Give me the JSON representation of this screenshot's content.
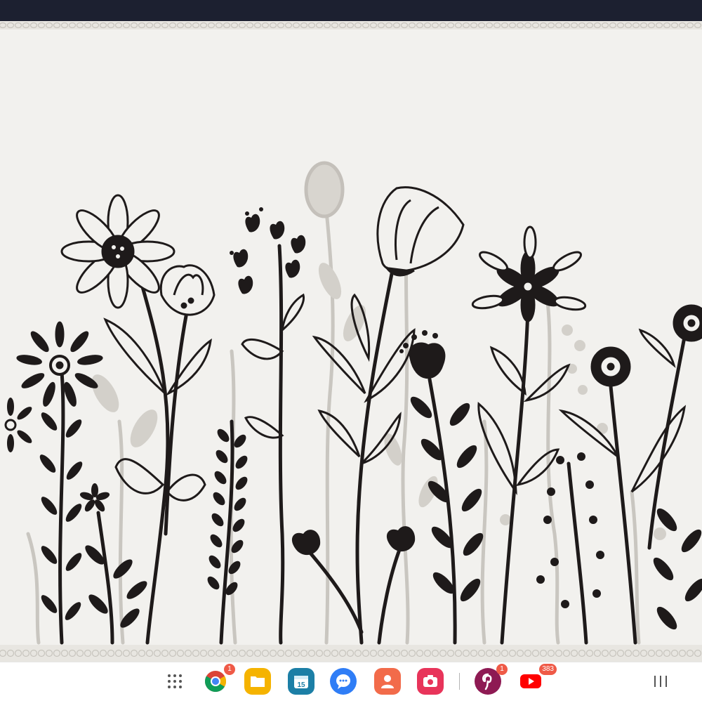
{
  "dock": {
    "apps": [
      {
        "name": "app-drawer",
        "icon": "grid-icon"
      },
      {
        "name": "chrome",
        "icon": "chrome-icon",
        "badge": "1"
      },
      {
        "name": "my-files",
        "icon": "folder-icon"
      },
      {
        "name": "calendar",
        "icon": "calendar-icon",
        "calendar_day": "15"
      },
      {
        "name": "messages",
        "icon": "chat-bubble-icon"
      },
      {
        "name": "contacts",
        "icon": "person-icon"
      },
      {
        "name": "screen-recorder",
        "icon": "camera-icon"
      },
      {
        "name": "pinterest",
        "icon": "pinterest-icon",
        "badge": "1"
      },
      {
        "name": "youtube",
        "icon": "play-icon",
        "badge": "383"
      }
    ],
    "recents_icon": "recents-icon"
  },
  "colors": {
    "status_bar": "#1c2030",
    "wallpaper": "#f2f1ee",
    "ink": "#1e1a1a",
    "badge": "#ef5a47"
  }
}
